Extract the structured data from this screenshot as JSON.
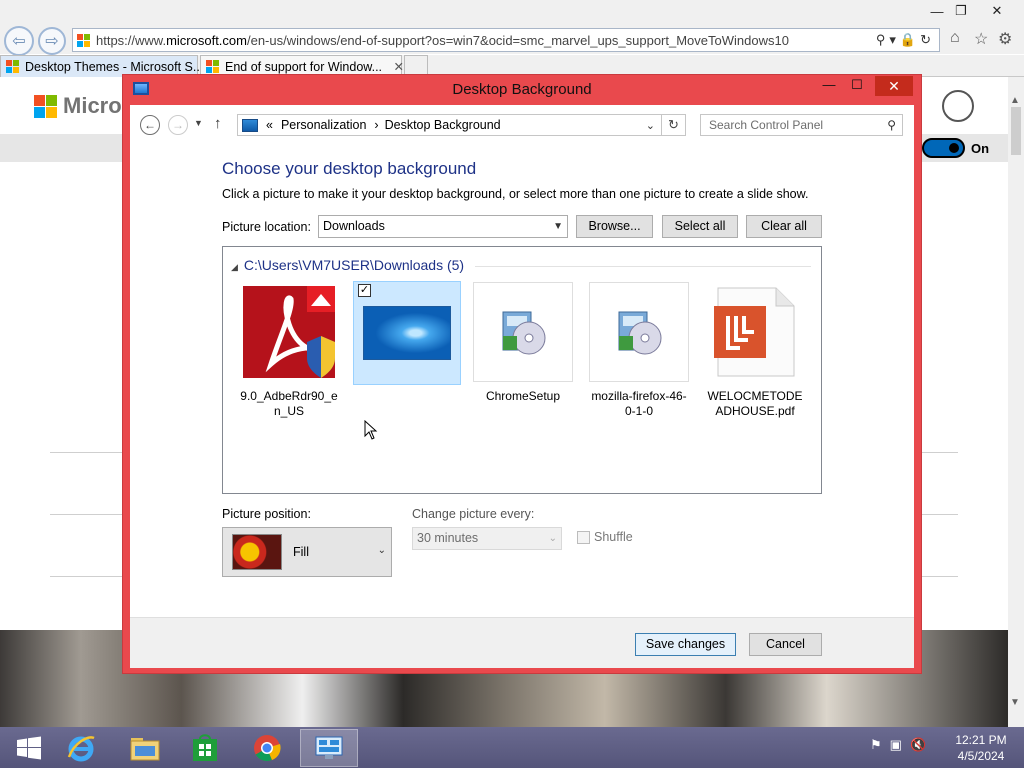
{
  "browser": {
    "url_prefix": "https://www.",
    "url_domain": "microsoft.com",
    "url_rest": "/en-us/windows/end-of-support?os=win7&ocid=smc_marvel_ups_support_MoveToWindows10",
    "tabs": [
      {
        "label": "Desktop Themes - Microsoft S...",
        "active": false
      },
      {
        "label": "End of support for Window...",
        "active": true
      }
    ],
    "tab_close_glyph": "✕",
    "window_controls": {
      "minimize": "—",
      "restore": "❐",
      "close": "✕"
    }
  },
  "webpage": {
    "logo_text": "Microso",
    "toggle_label": "On"
  },
  "dialog": {
    "title": "Desktop Background",
    "title_controls": {
      "minimize": "—",
      "maximize": "☐",
      "close": "✕"
    },
    "breadcrumb": {
      "root_glyph": "«",
      "parent": "Personalization",
      "separator": "›",
      "current": "Desktop Background"
    },
    "search_placeholder": "Search Control Panel",
    "heading": "Choose your desktop background",
    "description": "Click a picture to make it your desktop background, or select more than one picture to create a slide show.",
    "picture_location_label": "Picture location:",
    "picture_location_value": "Downloads",
    "buttons": {
      "browse": "Browse...",
      "select_all": "Select all",
      "clear_all": "Clear all",
      "save": "Save changes",
      "cancel": "Cancel"
    },
    "group_header": "C:\\Users\\VM7USER\\Downloads (5)",
    "items": [
      {
        "caption": "9.0_AdbeRdr90_en_US",
        "selected": false
      },
      {
        "caption": "",
        "selected": true
      },
      {
        "caption": "ChromeSetup",
        "selected": false
      },
      {
        "caption": "mozilla-firefox-46-0-1-0",
        "selected": false
      },
      {
        "caption": "WELOCMETODEADHOUSE.pdf",
        "selected": false
      }
    ],
    "picture_position_label": "Picture position:",
    "picture_position_value": "Fill",
    "change_every_label": "Change picture every:",
    "change_every_value": "30 minutes",
    "shuffle_label": "Shuffle",
    "shuffle_checked": false
  },
  "taskbar": {
    "items": [
      "start",
      "internet-explorer",
      "file-explorer",
      "store",
      "chrome",
      "control-panel"
    ],
    "time": "12:21 PM",
    "date": "4/5/2024"
  },
  "colors": {
    "dialog_frame": "#e9494d",
    "heading_blue": "#1e3287",
    "toggle_blue": "#0067b8",
    "taskbar": "#5f5f86"
  }
}
